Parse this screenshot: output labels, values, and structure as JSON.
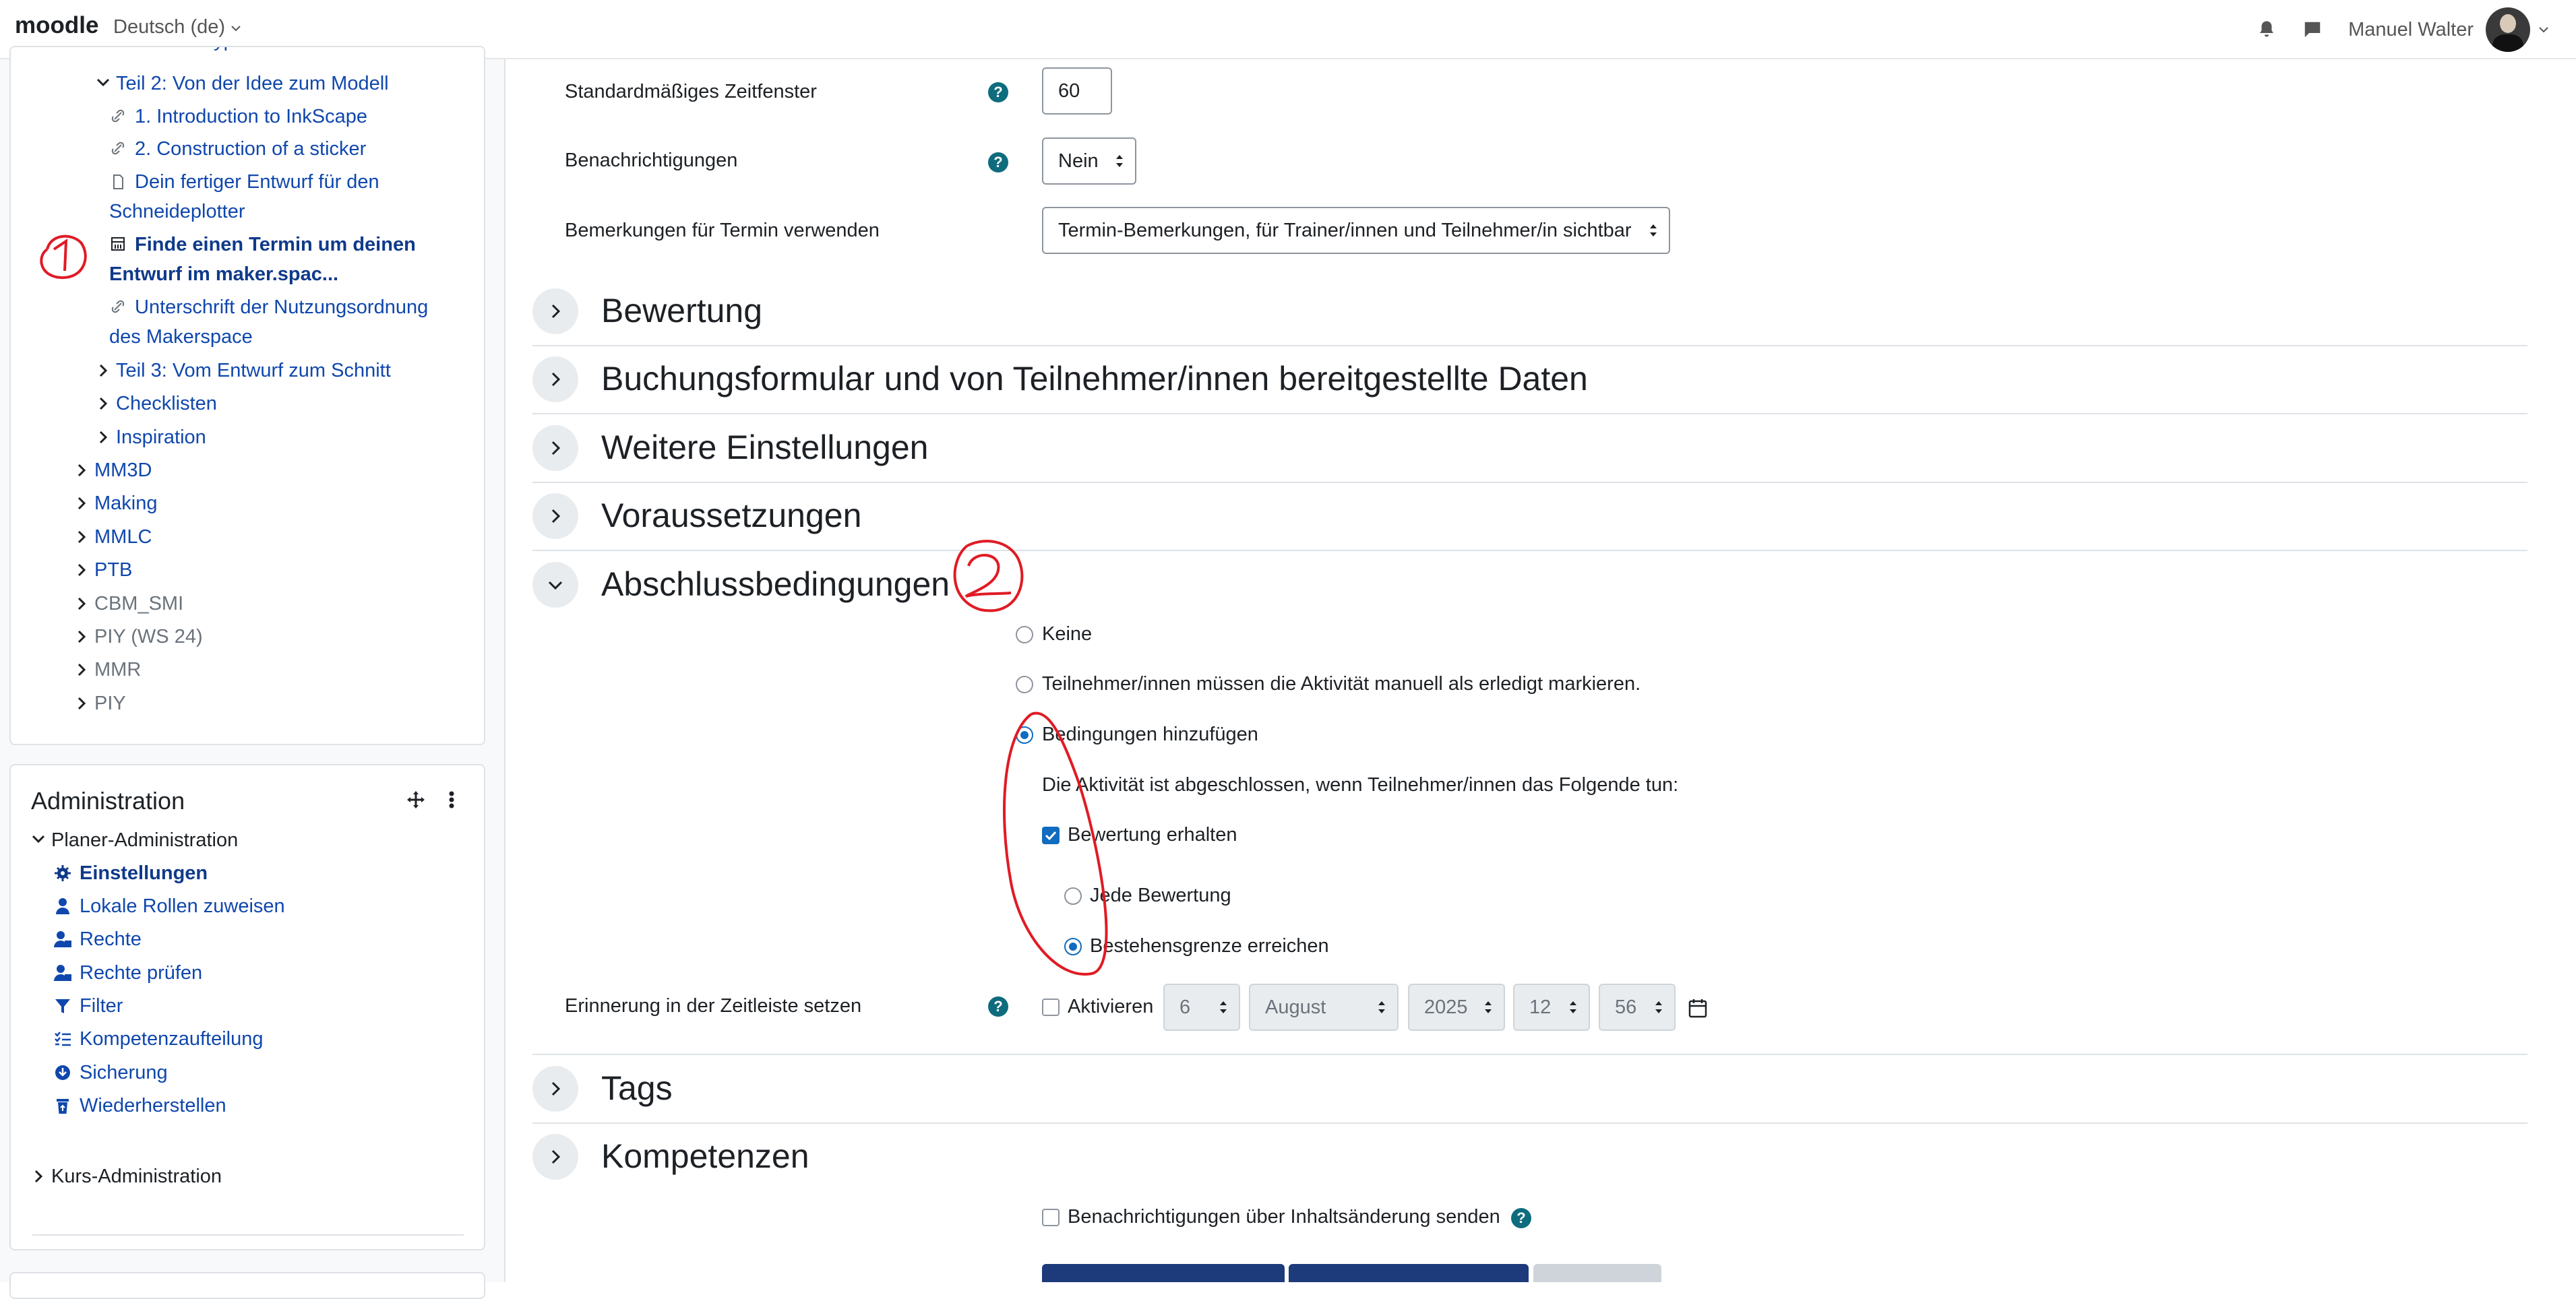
{
  "navbar": {
    "brand": "moodle",
    "language": "Deutsch (de)",
    "user_name": "Manuel Walter"
  },
  "course_index": {
    "items": [
      {
        "label": "Teil 2: Von der Idee zum Modell"
      },
      {
        "label": "1. Introduction to InkScape"
      },
      {
        "label": "2. Construction of a sticker"
      },
      {
        "label_line1": "Dein fertiger Entwurf für den",
        "label_line2": "Schneideplotter"
      },
      {
        "label_line1": "Finde einen Termin um deinen",
        "label_line2": "Entwurf im maker.spac..."
      },
      {
        "label_line1": "Unterschrift der Nutzungsordnung",
        "label_line2": "des Makerspace"
      },
      {
        "label": "Teil 3: Vom Entwurf zum Schnitt"
      },
      {
        "label": "Checklisten"
      },
      {
        "label": "Inspiration"
      },
      {
        "label": "MM3D"
      },
      {
        "label": "Making"
      },
      {
        "label": "MMLC"
      },
      {
        "label": "PTB"
      },
      {
        "label": "CBM_SMI"
      },
      {
        "label": "PIY (WS 24)"
      },
      {
        "label": "MMR"
      },
      {
        "label": "PIY"
      }
    ]
  },
  "administration": {
    "title": "Administration",
    "planer_admin": "Planer-Administration",
    "items": [
      {
        "label": "Einstellungen"
      },
      {
        "label": "Lokale Rollen zuweisen"
      },
      {
        "label": "Rechte"
      },
      {
        "label": "Rechte prüfen"
      },
      {
        "label": "Filter"
      },
      {
        "label": "Kompetenzaufteilung"
      },
      {
        "label": "Sicherung"
      },
      {
        "label": "Wiederherstellen"
      }
    ],
    "course_admin": "Kurs-Administration"
  },
  "form": {
    "zeitfenster": {
      "label": "Standardmäßiges Zeitfenster",
      "value": "60"
    },
    "benachrichtigungen": {
      "label": "Benachrichtigungen",
      "value": "Nein"
    },
    "bemerkungen": {
      "label": "Bemerkungen für Termin verwenden",
      "value": "Termin-Bemerkungen, für Trainer/innen und Teilnehmer/in sichtbar"
    },
    "sections": {
      "bewertung": "Bewertung",
      "buchungsformular": "Buchungsformular und von Teilnehmer/innen bereitgestellte Daten",
      "weitere": "Weitere Einstellungen",
      "voraussetzungen": "Voraussetzungen",
      "abschluss": "Abschlussbedingungen",
      "tags": "Tags",
      "kompetenzen": "Kompetenzen"
    },
    "completion": {
      "keine": "Keine",
      "manuell": "Teilnehmer/innen müssen die Aktivität manuell als erledigt markieren.",
      "bedingungen": "Bedingungen hinzufügen",
      "description": "Die Aktivität ist abgeschlossen, wenn Teilnehmer/innen das Folgende tun:",
      "bewertung_erhalten": "Bewertung erhalten",
      "jede_bewertung": "Jede Bewertung",
      "bestehensgrenze": "Bestehensgrenze erreichen",
      "selected": "Bedingungen hinzufügen"
    },
    "erinnerung": {
      "label": "Erinnerung in der Zeitleiste setzen",
      "aktivieren": "Aktivieren",
      "day": "6",
      "month": "August",
      "year": "2025",
      "hour": "12",
      "minute": "56"
    },
    "notify_changes": "Benachrichtigungen über Inhaltsänderung senden"
  },
  "colors": {
    "primary": "#0f6cbf",
    "link": "#0f47ad",
    "help": "#0f6c7e",
    "button_dark": "#1d3a7a",
    "annotation": "#e01b24"
  }
}
